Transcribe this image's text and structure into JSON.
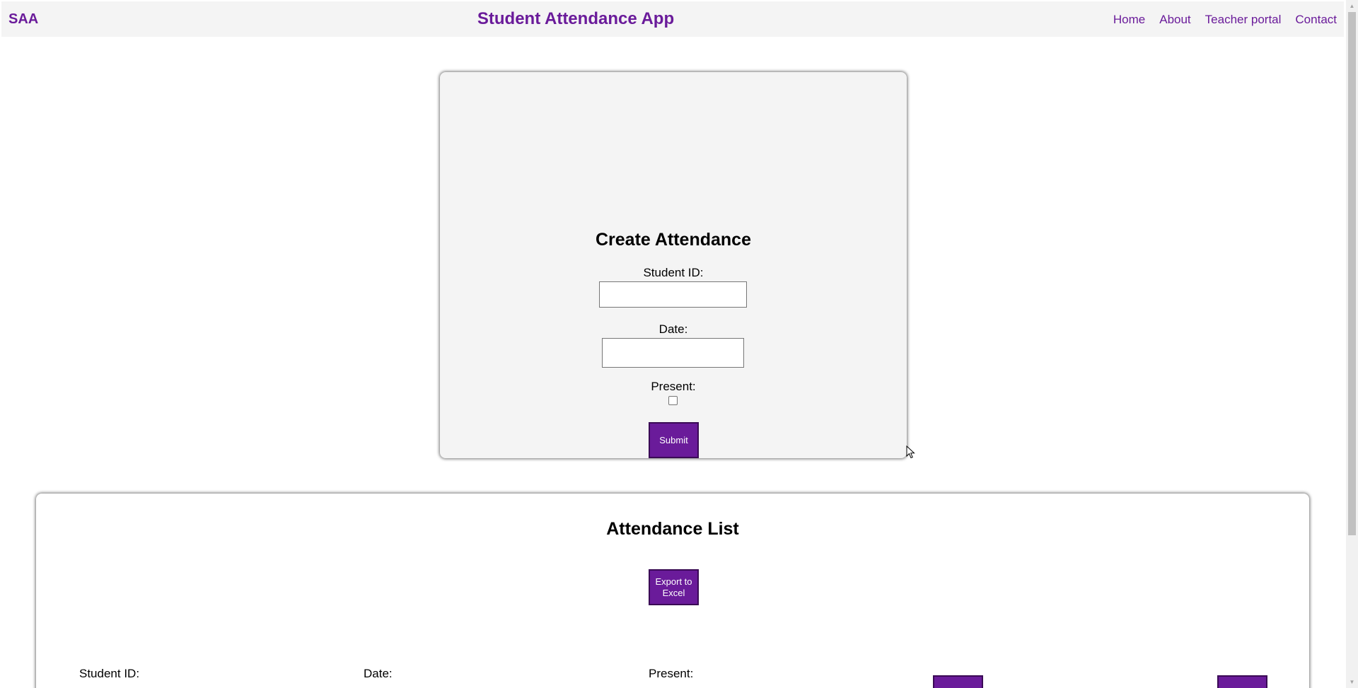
{
  "header": {
    "brand": "SAA",
    "title": "Student Attendance App",
    "nav": [
      "Home",
      "About",
      "Teacher portal",
      "Contact"
    ]
  },
  "create_form": {
    "title": "Create Attendance",
    "student_id_label": "Student ID:",
    "student_id_value": "",
    "date_label": "Date:",
    "date_value": "",
    "present_label": "Present:",
    "present_checked": false,
    "submit_label": "Submit"
  },
  "attendance_list": {
    "title": "Attendance List",
    "export_label": "Export to Excel",
    "columns": [
      "Student ID:",
      "Date:",
      "Present:"
    ]
  },
  "colors": {
    "accent": "#6a1b9a",
    "navbar_bg": "#f4f4f4",
    "card_bg": "#f4f4f4"
  }
}
